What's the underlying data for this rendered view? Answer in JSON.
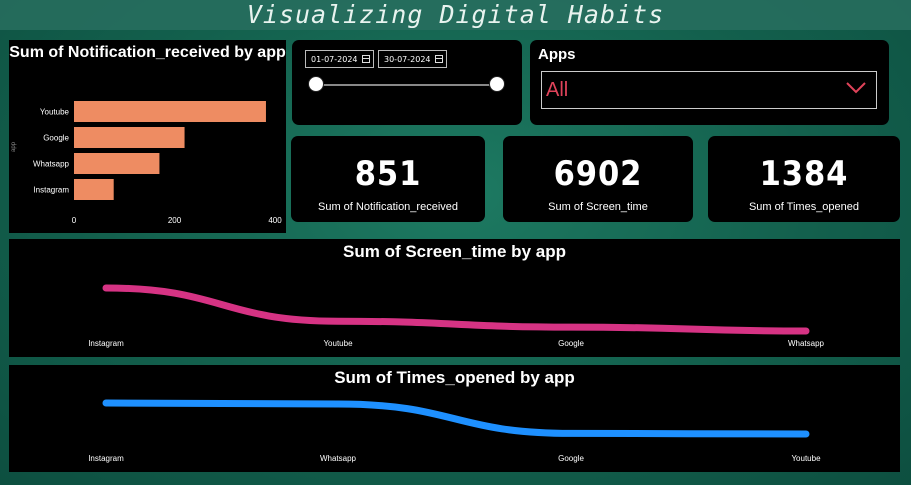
{
  "dashboard": {
    "title": "Visualizing Digital Habits"
  },
  "notif_chart": {
    "title": "Sum of Notification_received by app",
    "axis_label": "app",
    "ticks": [
      "0",
      "200",
      "400"
    ]
  },
  "date_slicer": {
    "start": "01-07-2024",
    "end": "30-07-2024"
  },
  "apps_slicer": {
    "label": "Apps",
    "value": "All"
  },
  "cards": [
    {
      "value": "851",
      "label": "Sum of Notification_received"
    },
    {
      "value": "6902",
      "label": "Sum of Screen_time"
    },
    {
      "value": "1384",
      "label": "Sum of Times_opened"
    }
  ],
  "screen_chart": {
    "title": "Sum of Screen_time by app",
    "color": "#d63384"
  },
  "opened_chart": {
    "title": "Sum of Times_opened by app",
    "color": "#1e90ff"
  },
  "chart_data": [
    {
      "type": "bar",
      "title": "Sum of Notification_received by app",
      "ylabel": "app",
      "categories": [
        "Youtube",
        "Google",
        "Whatsapp",
        "Instagram"
      ],
      "values": [
        382,
        220,
        170,
        79
      ],
      "xlim": [
        0,
        400
      ],
      "ticks": [
        0,
        200,
        400
      ],
      "color": "#ee8c62"
    },
    {
      "type": "line",
      "title": "Sum of Screen_time by app",
      "categories": [
        "Instagram",
        "Youtube",
        "Google",
        "Whatsapp"
      ],
      "values": [
        3200,
        1500,
        1200,
        1000
      ],
      "color": "#d63384"
    },
    {
      "type": "line",
      "title": "Sum of Times_opened by app",
      "categories": [
        "Instagram",
        "Whatsapp",
        "Google",
        "Youtube"
      ],
      "values": [
        500,
        490,
        200,
        194
      ],
      "color": "#1e90ff"
    }
  ]
}
